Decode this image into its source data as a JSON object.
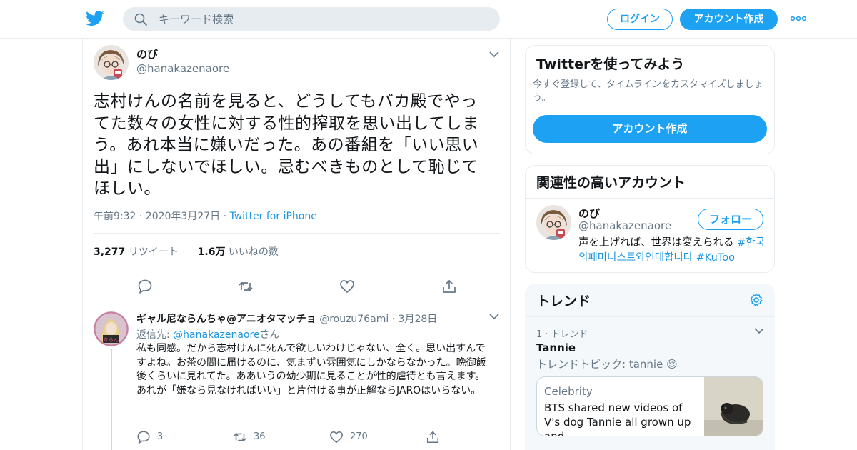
{
  "header": {
    "logo": "twitter-bird-logo",
    "search_placeholder": "キーワード検索",
    "login_label": "ログイン",
    "signup_label": "アカウント作成",
    "brand_color": "#1da1f2"
  },
  "tweet": {
    "name": "のび",
    "handle": "@hanakazenaore",
    "text": "志村けんの名前を見ると、どうしてもバカ殿でやってた数々の女性に対する性的搾取を思い出してしまう。あれ本当に嫌いだった。あの番組を「いい思い出」にしないでほしい。忌むべきものとして恥じてほしい。",
    "timestamp": "午前9:32 · 2020年3月27日 · ",
    "source": "Twitter for iPhone",
    "retweets_count": "3,277",
    "retweets_label": "リツイート",
    "likes_count": "1.6万",
    "likes_label": "いいねの数"
  },
  "reply": {
    "name": "ギャル尼ならんちゃ@アニオタマッチョ",
    "handle": "@rouzu76ami",
    "date": "3月28日",
    "reply_prefix": "返信先: ",
    "reply_to": "@hanakazenaore",
    "reply_suffix": "さん",
    "text": "私も同感。だから志村けんに死んで欲しいわけじゃない、全く。思い出すんですよね。お茶の間に届けるのに、気まずい雰囲気にしかならなかった。晩御飯後くらいに見れてた。ああいうの幼少期に見ることが性的虐待とも言えます。\nあれが「嫌なら見なければいい」と片付ける事が正解ならJAROはいらない。",
    "reply_count": "3",
    "retweet_count": "36",
    "like_count": "270"
  },
  "sidebar": {
    "try_twitter": {
      "title": "Twitterを使ってみよう",
      "description": "今すぐ登録して、タイムラインをカスタマイズしましょう。",
      "cta": "アカウント作成"
    },
    "related": {
      "title": "関連性の高いアカウント",
      "name": "のび",
      "handle": "@hanakazenaore",
      "follow_label": "フォロー",
      "bio_text": "声を上げれば、世界は変えられる ",
      "bio_tags": "#한국의페미니스트와연대합니다 #KuToo"
    },
    "trends": {
      "title": "トレンド",
      "rank_label": "1 · トレンド",
      "trend_name": "Tannie",
      "trend_topic": "トレンドトピック: tannie 😌",
      "news_category": "Celebrity",
      "news_headline": "BTS shared new videos of V's dog Tannie all grown up and ..."
    }
  }
}
